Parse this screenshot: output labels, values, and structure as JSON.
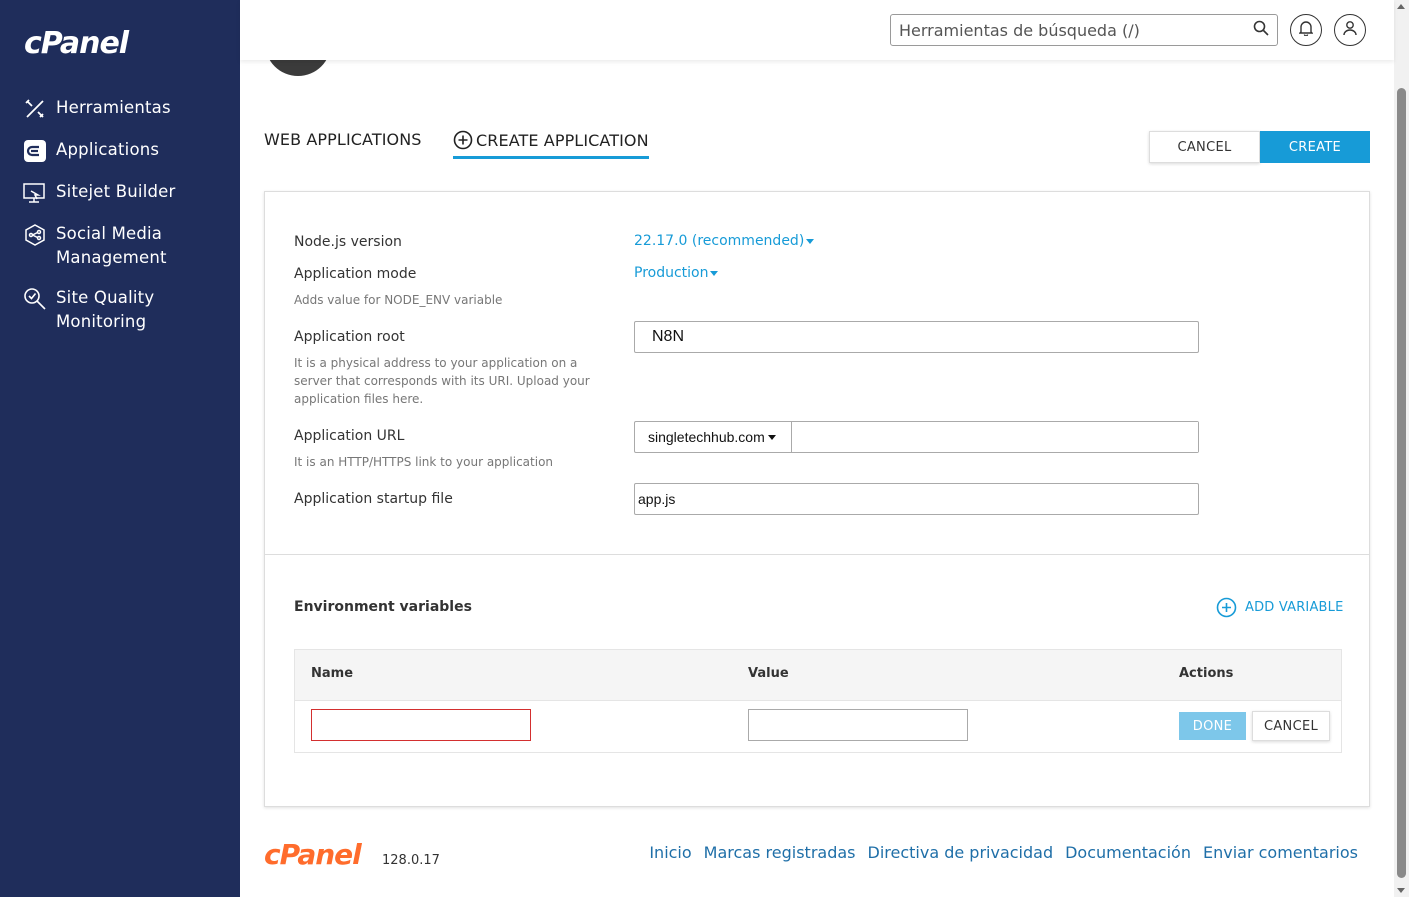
{
  "brand": {
    "logo_text": "cPanel",
    "version": "128.0.17"
  },
  "sidebar": {
    "items": [
      {
        "label": "Herramientas",
        "icon": "tools-icon"
      },
      {
        "label": "Applications",
        "icon": "applications-icon"
      },
      {
        "label": "Sitejet Builder",
        "icon": "sitejet-icon"
      },
      {
        "label": "Social Media Management",
        "icon": "social-media-icon"
      },
      {
        "label": "Site Quality Monitoring",
        "icon": "site-quality-icon"
      }
    ]
  },
  "header": {
    "search_placeholder": "Herramientas de búsqueda (/)"
  },
  "tabs": {
    "web_applications": "WEB APPLICATIONS",
    "create_application": "CREATE APPLICATION"
  },
  "actions": {
    "cancel": "CANCEL",
    "create": "CREATE"
  },
  "form": {
    "node_version": {
      "label": "Node.js version",
      "value": "22.17.0 (recommended)"
    },
    "app_mode": {
      "label": "Application mode",
      "value": "Production",
      "hint": "Adds value for NODE_ENV variable"
    },
    "app_root": {
      "label": "Application root",
      "value": "N8N",
      "hint": "It is a physical address to your application on a server that corresponds with its URI. Upload your application files here."
    },
    "app_url": {
      "label": "Application URL",
      "domain": "singletechhub.com",
      "path": "",
      "hint": "It is an HTTP/HTTPS link to your application"
    },
    "startup_file": {
      "label": "Application startup file",
      "value": "app.js"
    }
  },
  "env": {
    "title": "Environment variables",
    "add_label": "ADD VARIABLE",
    "columns": {
      "name": "Name",
      "value": "Value",
      "actions": "Actions"
    },
    "row": {
      "name": "",
      "value": "",
      "done": "DONE",
      "cancel": "CANCEL"
    }
  },
  "footer": {
    "links": [
      "Inicio",
      "Marcas registradas",
      "Directiva de privacidad",
      "Documentación",
      "Enviar comentarios"
    ]
  },
  "colors": {
    "sidebar": "#1f2d5b",
    "accent": "#179bd7",
    "footer_logo": "#ff6c2c",
    "error": "#d32f2f"
  }
}
